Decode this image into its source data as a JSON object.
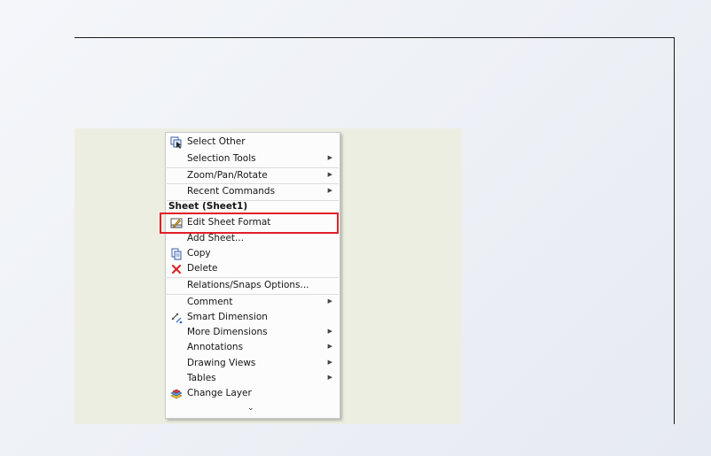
{
  "menu": {
    "items_top": [
      {
        "label": "Select Other",
        "icon": "select-other-icon",
        "submenu": false
      },
      {
        "label": "Selection Tools",
        "icon": "",
        "submenu": true
      },
      {
        "label": "Zoom/Pan/Rotate",
        "icon": "",
        "submenu": true
      },
      {
        "label": "Recent Commands",
        "icon": "",
        "submenu": true
      }
    ],
    "section_header": "Sheet (Sheet1)",
    "items_sheet": [
      {
        "label": "Edit Sheet Format",
        "icon": "edit-sheet-format-icon",
        "submenu": false
      },
      {
        "label": "Add Sheet...",
        "icon": "",
        "submenu": false
      },
      {
        "label": "Copy",
        "icon": "copy-icon",
        "submenu": false
      },
      {
        "label": "Delete",
        "icon": "delete-icon",
        "submenu": false
      }
    ],
    "items_bottom": [
      {
        "label": "Relations/Snaps Options...",
        "icon": "",
        "submenu": false
      },
      {
        "label": "Comment",
        "icon": "",
        "submenu": true
      },
      {
        "label": "Smart Dimension",
        "icon": "smart-dimension-icon",
        "submenu": false
      },
      {
        "label": "More Dimensions",
        "icon": "",
        "submenu": true
      },
      {
        "label": "Annotations",
        "icon": "",
        "submenu": true
      },
      {
        "label": "Drawing Views",
        "icon": "",
        "submenu": true
      },
      {
        "label": "Tables",
        "icon": "",
        "submenu": true
      },
      {
        "label": "Change Layer",
        "icon": "change-layer-icon",
        "submenu": false
      }
    ],
    "more_glyph": "⌄",
    "submenu_glyph": "▶"
  },
  "colors": {
    "highlight": "#e0202a",
    "canvas": "#edeee2",
    "delete_icon": "#d9262c"
  }
}
